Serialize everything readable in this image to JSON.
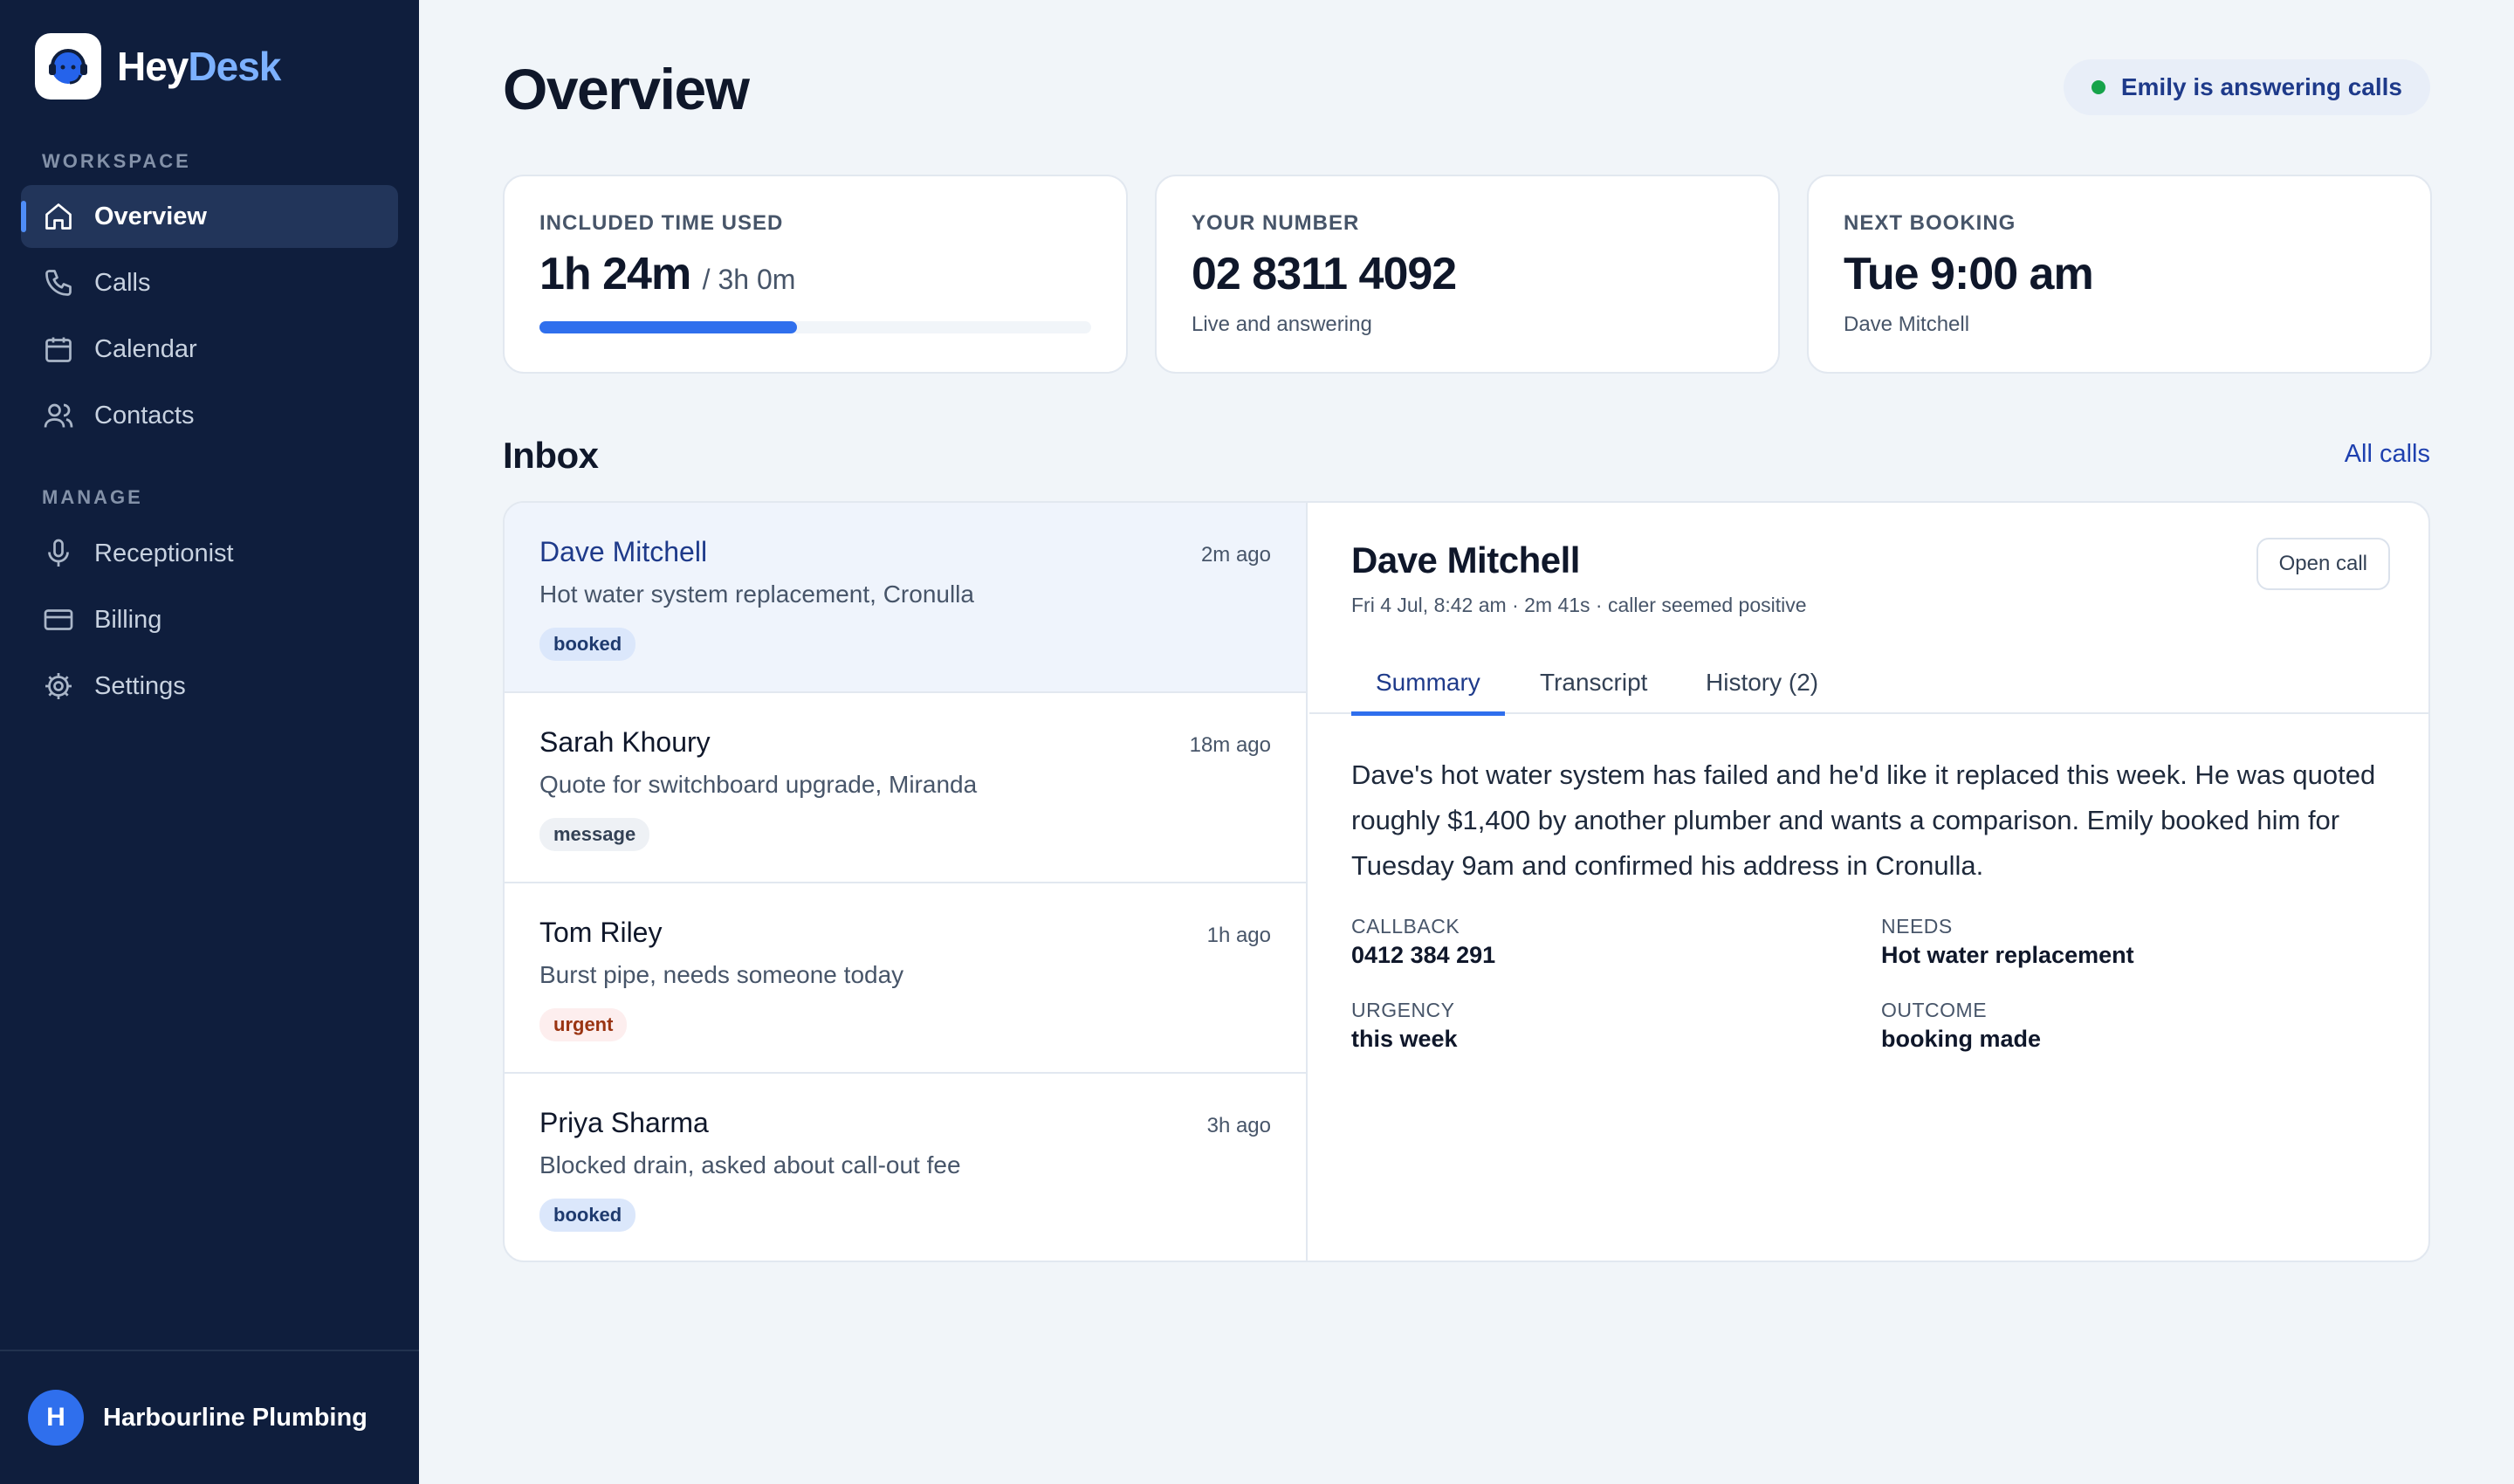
{
  "app": {
    "brand_part1": "Hey",
    "brand_part2": "Desk"
  },
  "sidebar": {
    "workspace_label": "WORKSPACE",
    "manage_label": "MANAGE",
    "workspace_items": [
      {
        "label": "Overview",
        "icon": "home-icon",
        "active": true
      },
      {
        "label": "Calls",
        "icon": "phone-icon"
      },
      {
        "label": "Calendar",
        "icon": "calendar-icon"
      },
      {
        "label": "Contacts",
        "icon": "users-icon"
      }
    ],
    "manage_items": [
      {
        "label": "Receptionist",
        "icon": "microphone-icon"
      },
      {
        "label": "Billing",
        "icon": "credit-card-icon"
      },
      {
        "label": "Settings",
        "icon": "gear-icon"
      }
    ],
    "footer": {
      "avatar_initial": "H",
      "org_name": "Harbourline Plumbing"
    }
  },
  "header": {
    "title": "Overview",
    "status": "Emily is answering calls",
    "status_color": "#16a34a"
  },
  "cards": {
    "time_used": {
      "label": "INCLUDED TIME USED",
      "value": "1h 24m",
      "of": "/ 3h 0m",
      "progress_fraction": 0.467
    },
    "number": {
      "label": "YOUR NUMBER",
      "value": "02 8311 4092",
      "sub": "Live and answering"
    },
    "booking": {
      "label": "NEXT BOOKING",
      "value": "Tue 9:00 am",
      "sub": "Dave Mitchell"
    }
  },
  "inbox": {
    "title": "Inbox",
    "all_calls_link": "All calls",
    "items": [
      {
        "name": "Dave Mitchell",
        "time": "2m ago",
        "summary": "Hot water system replacement, Cronulla",
        "tag": "booked"
      },
      {
        "name": "Sarah Khoury",
        "time": "18m ago",
        "summary": "Quote for switchboard upgrade, Miranda",
        "tag": "message"
      },
      {
        "name": "Tom Riley",
        "time": "1h ago",
        "summary": "Burst pipe, needs someone today",
        "tag": "urgent"
      },
      {
        "name": "Priya Sharma",
        "time": "3h ago",
        "summary": "Blocked drain, asked about call-out fee",
        "tag": "booked"
      }
    ]
  },
  "detail": {
    "name": "Dave Mitchell",
    "meta": "Fri 4 Jul, 8:42 am · 2m 41s · caller seemed positive",
    "open_call_label": "Open call",
    "tabs": [
      "Summary",
      "Transcript",
      "History (2)"
    ],
    "active_tab": "Summary",
    "summary": "Dave's hot water system has failed and he'd like it replaced this week. He was quoted roughly $1,400 by another plumber and wants a comparison. Emily booked him for Tuesday 9am and confirmed his address in Cronulla.",
    "fields": {
      "callback": {
        "label": "CALLBACK",
        "value": "0412 384 291"
      },
      "needs": {
        "label": "NEEDS",
        "value": "Hot water replacement"
      },
      "urgency": {
        "label": "URGENCY",
        "value": "this week"
      },
      "outcome": {
        "label": "OUTCOME",
        "value": "booking made"
      }
    }
  },
  "colors": {
    "sidebar_bg": "#0f1e3d",
    "accent": "#2f6fed",
    "page_bg": "#f1f5f9"
  }
}
